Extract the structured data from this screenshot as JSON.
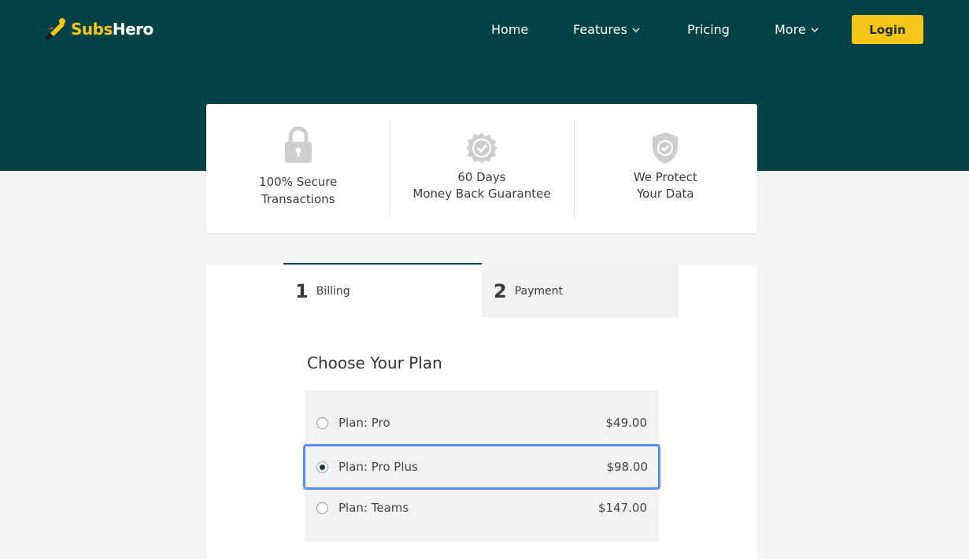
{
  "header": {
    "logo": {
      "part1": "Subs",
      "part2": "Hero"
    },
    "nav": [
      {
        "label": "Home",
        "has_dropdown": false
      },
      {
        "label": "Features",
        "has_dropdown": true
      },
      {
        "label": "Pricing",
        "has_dropdown": false
      },
      {
        "label": "More",
        "has_dropdown": true
      }
    ],
    "login_label": "Login"
  },
  "trust": [
    {
      "icon": "lock-icon",
      "text": "100% Secure\nTransactions"
    },
    {
      "icon": "badge-check-icon",
      "text": "60 Days\nMoney Back Guarantee"
    },
    {
      "icon": "shield-check-icon",
      "text": "We Protect\nYour Data"
    }
  ],
  "steps": [
    {
      "number": "1",
      "label": "Billing",
      "active": true
    },
    {
      "number": "2",
      "label": "Payment",
      "active": false
    }
  ],
  "plans_section": {
    "title": "Choose Your Plan",
    "plans": [
      {
        "name": "Plan: Pro",
        "price": "$49.00",
        "selected": false
      },
      {
        "name": "Plan: Pro Plus",
        "price": "$98.00",
        "selected": true
      },
      {
        "name": "Plan: Teams",
        "price": "$147.00",
        "selected": false
      }
    ]
  },
  "colors": {
    "hero_bg": "#024246",
    "accent_yellow": "#f5c518",
    "focus_outline": "#5b8def",
    "page_bg": "#f5f5f5"
  }
}
